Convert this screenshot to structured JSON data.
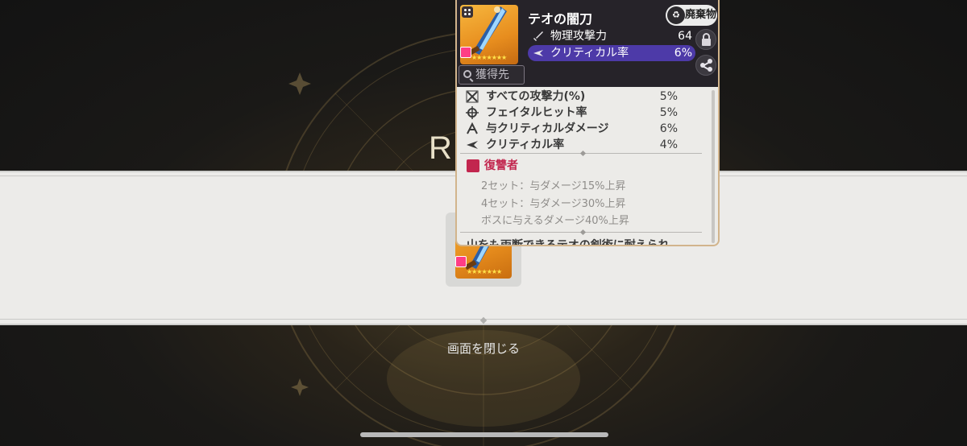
{
  "background": {
    "reward_title": "RE",
    "close_label": "画面を閉じる"
  },
  "item_slot": {
    "stars": "★★★★★★★"
  },
  "tooltip": {
    "item_name": "テオの闇刀",
    "junk_label": "廃棄物",
    "acquire_label": "獲得先",
    "stars": "★★★★★★★",
    "main_stats": [
      {
        "label": "物理攻撃力",
        "value": "64",
        "icon": "sword-icon",
        "highlighted": false
      },
      {
        "label": "クリティカル率",
        "value": "6%",
        "icon": "crit-icon",
        "highlighted": true
      }
    ],
    "sub_stats": [
      {
        "label": "すべての攻撃力(%)",
        "value": "5%",
        "icon": "all-attack-icon"
      },
      {
        "label": "フェイタルヒット率",
        "value": "5%",
        "icon": "fatal-hit-icon"
      },
      {
        "label": "与クリティカルダメージ",
        "value": "6%",
        "icon": "crit-damage-icon"
      },
      {
        "label": "クリティカル率",
        "value": "4%",
        "icon": "crit-icon"
      }
    ],
    "set": {
      "name": "復讐者",
      "lines": [
        "2セット：与ダメージ15%上昇",
        "4セット：与ダメージ30%上昇",
        "ボスに与えるダメージ40%上昇"
      ]
    },
    "flavor_text": "山をも両断できるテオの剣術に耐えられ"
  },
  "colors": {
    "highlight": "#4d3aa8",
    "set_accent": "#c2264e",
    "frame_gold": "#d2b48c"
  }
}
